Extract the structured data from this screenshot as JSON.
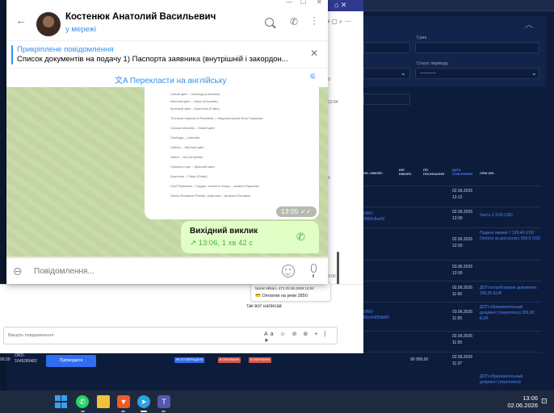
{
  "crm": {
    "top_tab": "≡ ◻ ⌕ ⋯",
    "panel": {
      "label_sum": "Сума",
      "label_status": "Статус переводу",
      "status_value": "----------"
    },
    "table_headers": [
      "НО. ІНВОЙС",
      "ЮР. ІНВОЙС",
      "ПЛ. ПОСИЛАННЯ",
      "ДАТА СТВОРЕННЯ",
      "CRM URL"
    ],
    "rows": [
      {
        "left": "",
        "date": "02.06.2026",
        "time": "12:12",
        "crm": ""
      },
      {
        "left": "ORD-\n3000cfbe03",
        "date": "02.06.2026",
        "time": "12:00",
        "crm": "Часть 2 3.00 USD"
      },
      {
        "left": "",
        "date": "02.06.2026",
        "time": "12:00",
        "crm": "Подача ликвая 7 329,40 USD\nОплата за доп.услугу 650,0 USD"
      },
      {
        "left": "",
        "date": "03.06.2026",
        "time": "12:00",
        "crm": ""
      },
      {
        "left": "",
        "date": "02.06.2026",
        "time": "11:56",
        "crm": "ДОП.потребованиe документа 200,00 EUR"
      },
      {
        "left": "ORD-\nf0ec5485db80",
        "date": "03.06.2026",
        "time": "11:55",
        "crm": "ДОП.образовательный документ (переплата) 300,00 EUR"
      },
      {
        "left": "",
        "date": "02.06.2026",
        "time": "11:55",
        "crm": ""
      },
      {
        "left": "",
        "date": "02.06.2026",
        "time": "11:37",
        "crm": ""
      },
      {
        "left": "",
        "date": "",
        "time": "",
        "crm": "ДОП.образовательный документ (переплата)"
      }
    ],
    "bottom": {
      "amount_left": "99,00",
      "ord": "ORD-\n1649289483",
      "confirm_label": "Підтвердити",
      "badge1": "НЕ ПОТВЕРЖДЕНО",
      "badge2": "В ОЧІКУВАННІ",
      "badge3": "В ОЧІКУВАННІ",
      "amount_right": "90 999,00"
    }
  },
  "mid_chat": {
    "top_tab": "⌂ ✕",
    "quoted_author": "Nazar Mihai L 471  02.06.2026 13:04",
    "quoted_text": "💳 Оплатив на реки 2850",
    "message_text": "так вот написав",
    "time_side_1": "13:04",
    "time_side_2": "0",
    "time_side_3": "0",
    "time_side_4": "3:06",
    "input_placeholder": "Введіть повідомлення",
    "input_tools": "Aa ☺ ⊘ ⊚ + | ➤"
  },
  "telegram": {
    "window_controls": [
      "—",
      "☐",
      "✕"
    ],
    "contact_name": "Костенюк Анатолий Васильевич",
    "status": "у мережі",
    "pinned_title": "Прикріплене повідомлення",
    "pinned_text": "Список документів на подачу  1) Паспорта заявника (внутрішній і закордон...",
    "translate_label": "Перекласти на англійську",
    "doc_lines": [
      "Синий цвет – Свобода (Libertate)",
      "Желтый цвет – Закон (Dreptate)",
      "Красный цвет – Братство (Frăție)",
      "",
      "Tricolorul național al României – Национальный Флаг Румынии",
      "",
      "Culoare albastră – Синий цвет",
      "",
      "Свобода – Libertate",
      "",
      "Galben – Жёлтый цвет",
      "",
      "Закон – Act (Dreptate)",
      "",
      "Culoarea roșu – Красный цвет",
      "",
      "Братство – Frăție (Frăție)",
      "",
      "Герб Румынии – Гордое, сильное птица – символ Румынии",
      "",
      "Stema României Pasăre, puternică – simbolul României"
    ],
    "doc_time": "13:05",
    "call_title": "Вихідний виклик",
    "call_meta": "↗ 13:06, 1 хв 42 с",
    "composer_placeholder": "Повідомлення..."
  },
  "taskbar": {
    "clock_time": "13:06",
    "clock_date": "02.06.2026"
  },
  "colors": {
    "telegram_accent": "#3390ec",
    "call_green": "#4fae4e",
    "crm_bg": "#0d1c3a",
    "crm_link": "#4a86ff"
  }
}
